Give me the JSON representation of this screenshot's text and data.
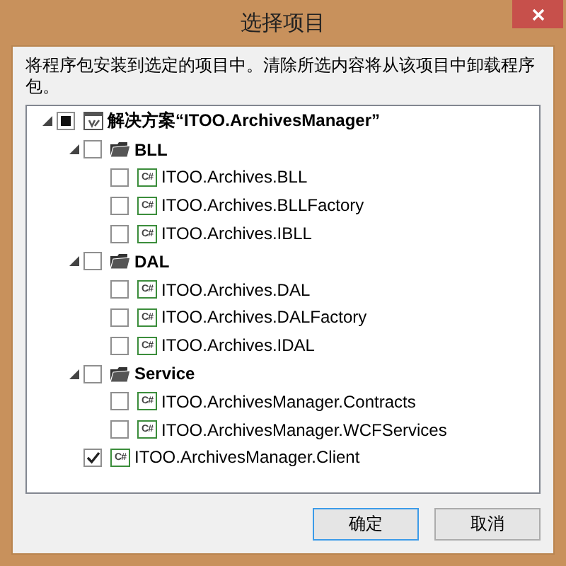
{
  "window": {
    "title": "选择项目"
  },
  "description": "将程序包安装到选定的项目中。清除所选内容将从该项目中卸载程序包。",
  "tree": [
    {
      "kind": "solution",
      "label": "解决方案“ITOO.ArchivesManager”",
      "checked": false,
      "partial": true,
      "expanded": true,
      "children": [
        {
          "kind": "folder",
          "label": "BLL",
          "checked": false,
          "expanded": true,
          "children": [
            {
              "kind": "project",
              "icon_label": "C#",
              "label": "ITOO.Archives.BLL",
              "checked": false
            },
            {
              "kind": "project",
              "icon_label": "C#",
              "label": "ITOO.Archives.BLLFactory",
              "checked": false
            },
            {
              "kind": "project",
              "icon_label": "C#",
              "label": "ITOO.Archives.IBLL",
              "checked": false
            }
          ]
        },
        {
          "kind": "folder",
          "label": "DAL",
          "checked": false,
          "expanded": true,
          "children": [
            {
              "kind": "project",
              "icon_label": "C#",
              "label": "ITOO.Archives.DAL",
              "checked": false
            },
            {
              "kind": "project",
              "icon_label": "C#",
              "label": "ITOO.Archives.DALFactory",
              "checked": false
            },
            {
              "kind": "project",
              "icon_label": "C#",
              "label": "ITOO.Archives.IDAL",
              "checked": false
            }
          ]
        },
        {
          "kind": "folder",
          "label": "Service",
          "checked": false,
          "expanded": true,
          "children": [
            {
              "kind": "project",
              "icon_label": "C#",
              "label": "ITOO.ArchivesManager.Contracts",
              "checked": false
            },
            {
              "kind": "project",
              "icon_label": "C#",
              "label": "ITOO.ArchivesManager.WCFServices",
              "checked": false
            }
          ]
        },
        {
          "kind": "project",
          "icon_label": "C#",
          "label": "ITOO.ArchivesManager.Client",
          "checked": true
        }
      ]
    }
  ],
  "buttons": [
    {
      "label": "确定",
      "default": true
    },
    {
      "label": "取消",
      "default": false
    }
  ]
}
